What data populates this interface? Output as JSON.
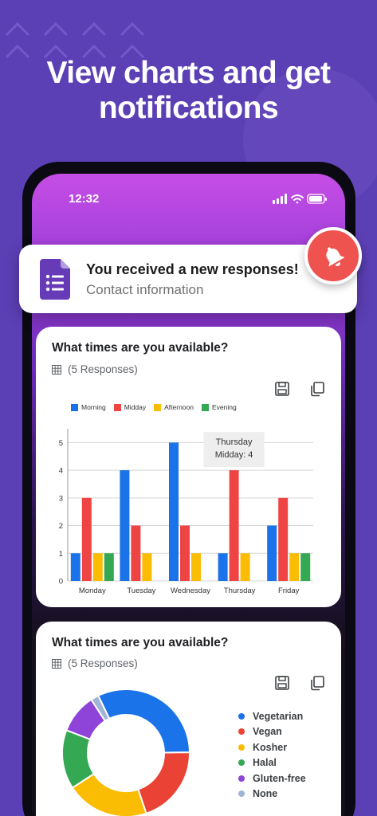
{
  "headline": {
    "line1": "View charts and get",
    "line2": "notifications"
  },
  "status_bar": {
    "time": "12:32"
  },
  "notification": {
    "title": "You received a new responses!",
    "subtitle": "Contact information",
    "icon": "google-forms-icon",
    "badge_icon": "bell-icon",
    "badge_color": "#ef5350"
  },
  "card1": {
    "title": "What times are you available?",
    "responses": "(5 Responses)",
    "tooltip": {
      "line1": "Thursday",
      "line2": "Midday: 4"
    }
  },
  "card2": {
    "title": "What times are you available?",
    "responses": "(5 Responses)"
  },
  "chart_data": [
    {
      "type": "bar",
      "categories": [
        "Monday",
        "Tuesday",
        "Wednesday",
        "Thursday",
        "Friday"
      ],
      "series": [
        {
          "name": "Morning",
          "color": "#1a73e8",
          "values": [
            1,
            4,
            5,
            1,
            2
          ]
        },
        {
          "name": "Midday",
          "color": "#ef4444",
          "values": [
            3,
            2,
            2,
            4,
            3
          ]
        },
        {
          "name": "Afternoon",
          "color": "#fbbc04",
          "values": [
            1,
            1,
            1,
            1,
            1
          ]
        },
        {
          "name": "Evening",
          "color": "#34a853",
          "values": [
            1,
            0,
            0,
            0,
            1
          ]
        }
      ],
      "yticks": [
        "0",
        "1",
        "2",
        "3",
        "4",
        "5"
      ],
      "ylim": [
        0,
        5.5
      ],
      "grid": true,
      "legend": "top"
    },
    {
      "type": "pie",
      "donut": true,
      "labels": [
        "Vegetarian",
        "Vegan",
        "Kosher",
        "Halal",
        "Gluten-free",
        "None"
      ],
      "colors": [
        "#1a73e8",
        "#ea4335",
        "#fbbc04",
        "#34a853",
        "#8e44d8",
        "#a0b4d6"
      ],
      "values": [
        32,
        20,
        21,
        15,
        10,
        2
      ],
      "legend": "right"
    }
  ]
}
